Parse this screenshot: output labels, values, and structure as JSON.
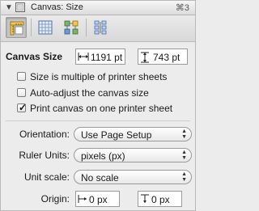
{
  "window": {
    "title": "Canvas: Size",
    "shortcut": "⌘3"
  },
  "toolbar": {
    "tabs": [
      {
        "name": "canvas-size",
        "icon": "ruler-tab-icon",
        "active": true
      },
      {
        "name": "grid",
        "icon": "grid-icon",
        "active": false
      },
      {
        "name": "layers",
        "icon": "layers-icon",
        "active": false
      },
      {
        "name": "layout",
        "icon": "layout-tree-icon",
        "active": false
      }
    ]
  },
  "canvas_size": {
    "label": "Canvas Size",
    "width": "1191 pt",
    "height": "743 pt"
  },
  "options": {
    "size_multiple": {
      "label": "Size is multiple of printer sheets",
      "checked": false
    },
    "auto_adjust": {
      "label": "Auto-adjust the canvas size",
      "checked": false
    },
    "print_one_sheet": {
      "label": "Print canvas on one printer sheet",
      "checked": true
    }
  },
  "fields": {
    "orientation": {
      "label": "Orientation:",
      "value": "Use Page Setup"
    },
    "ruler_units": {
      "label": "Ruler Units:",
      "value": "pixels (px)"
    },
    "unit_scale": {
      "label": "Unit scale:",
      "value": "No scale"
    },
    "origin": {
      "label": "Origin:",
      "x": "0 px",
      "y": "0 px"
    }
  },
  "colors": {
    "panel_bg": "#ececec",
    "border": "#9b9b9b"
  }
}
